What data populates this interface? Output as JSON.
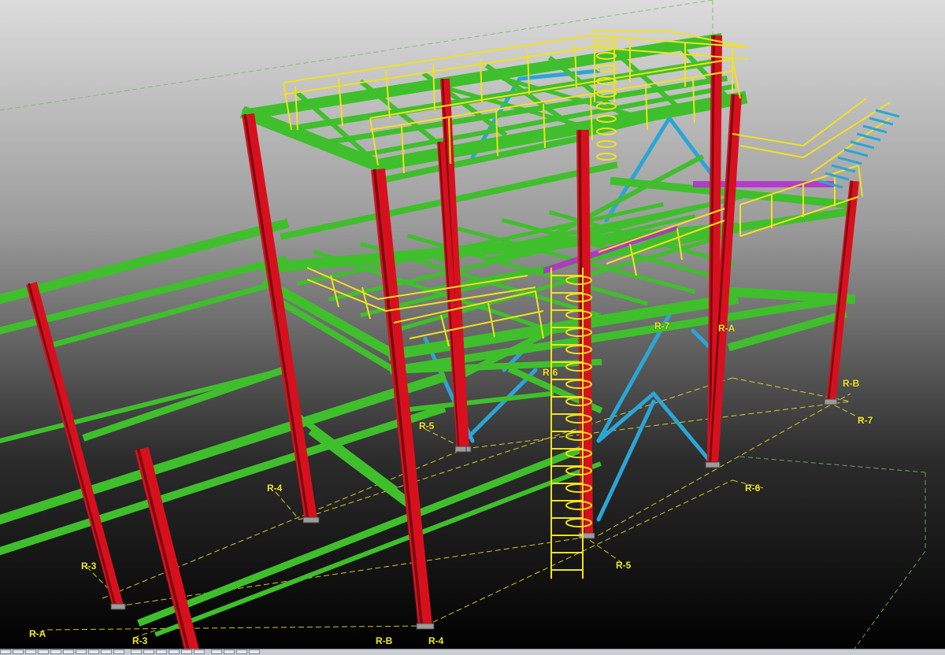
{
  "viewport": {
    "background_top": "#d6d6d6",
    "background_bottom": "#000000",
    "colors": {
      "column": "#d8101e",
      "beam": "#3fbf2c",
      "railing": "#f0e21f",
      "brace": "#2aa6d6",
      "plate": "#b52ad0",
      "gridline": "#f2ea2c"
    }
  },
  "grid_labels": [
    {
      "id": "r7-top",
      "text": "R-7"
    },
    {
      "id": "ra-top",
      "text": "R-A"
    },
    {
      "id": "r6-mid",
      "text": "R-6"
    },
    {
      "id": "rb-right",
      "text": "R-B"
    },
    {
      "id": "r7-right",
      "text": "R-7"
    },
    {
      "id": "r5-mid",
      "text": "R-5"
    },
    {
      "id": "r6-right",
      "text": "R-6"
    },
    {
      "id": "r4-left",
      "text": "R-4"
    },
    {
      "id": "r5-bottom",
      "text": "R-5"
    },
    {
      "id": "r3-left",
      "text": "R-3"
    },
    {
      "id": "ra-left",
      "text": "R-A"
    },
    {
      "id": "r3-bottom",
      "text": "R-3"
    },
    {
      "id": "rb-bottom",
      "text": "R-B"
    },
    {
      "id": "r4-bottom",
      "text": "R-4"
    }
  ],
  "toolbar": {
    "buttons": [
      "view-button",
      "zoom-button",
      "pan-button",
      "rotate-button",
      "select-button",
      "measure-button",
      "snap-button",
      "grid-button",
      "layer-button",
      "render-button",
      "wireframe-button",
      "shaded-button",
      "filter-button",
      "property-button",
      "print-button",
      "export-button",
      "undo-button",
      "redo-button",
      "help-button",
      "settings-button"
    ]
  }
}
